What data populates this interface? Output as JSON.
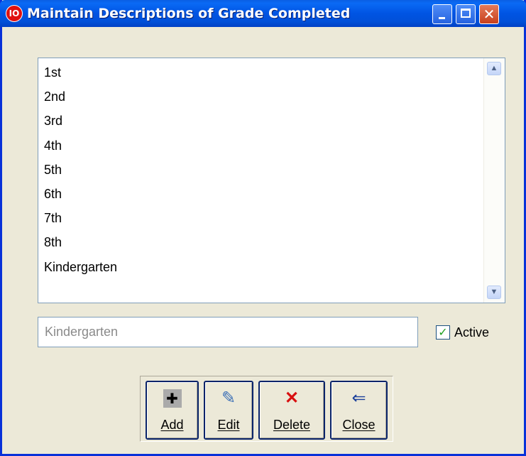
{
  "window": {
    "title": "Maintain Descriptions of Grade Completed",
    "app_icon": "io-logo-icon",
    "controls": {
      "minimize": "minimize-icon",
      "maximize": "maximize-icon",
      "close": "close-icon",
      "close_glyph": "✕"
    }
  },
  "grade_list": {
    "items": [
      "1st",
      "2nd",
      "3rd",
      "4th",
      "5th",
      "6th",
      "7th",
      "8th",
      "Kindergarten"
    ],
    "scroll_up_glyph": "▲",
    "scroll_down_glyph": "▼"
  },
  "description_field": {
    "value": "Kindergarten"
  },
  "active_checkbox": {
    "label": "Active",
    "checked": true,
    "check_glyph": "✓"
  },
  "toolbar": {
    "add": {
      "label": "Add",
      "icon": "plus-icon",
      "glyph": "✚"
    },
    "edit": {
      "label": "Edit",
      "icon": "edit-pencil-icon",
      "glyph": "✎"
    },
    "delete": {
      "label": "Delete",
      "icon": "red-x-icon",
      "glyph": "✕"
    },
    "close": {
      "label": "Close",
      "icon": "exit-door-icon",
      "glyph": "⇐"
    }
  },
  "colors": {
    "titlebar": "#0054e3",
    "window_bg": "#ece9d8",
    "delete_icon": "#d81010",
    "check_green": "#21a121"
  }
}
